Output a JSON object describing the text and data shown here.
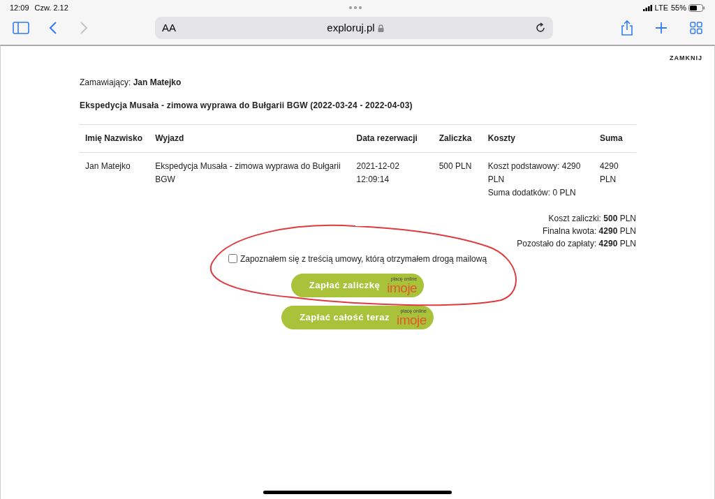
{
  "status_bar": {
    "time": "12:09",
    "date": "Czw. 2.12",
    "network": "LTE",
    "battery": "55%"
  },
  "browser": {
    "reader_button": "AA",
    "url": "exploruj.pl"
  },
  "close_link": "ZAMKNIJ",
  "orderer": {
    "label": "Zamawiający:",
    "name": "Jan Matejko"
  },
  "trip_title": "Ekspedycja Musała - zimowa wyprawa do Bułgarii BGW (2022-03-24 - 2022-04-03)",
  "table": {
    "columns": [
      "Imię Nazwisko",
      "Wyjazd",
      "Data rezerwacji",
      "Zaliczka",
      "Koszty",
      "Suma"
    ],
    "rows": [
      [
        "Jan Matejko",
        "Ekspedycja Musała - zimowa wyprawa do Bułgarii BGW",
        "2021-12-02 12:09:14",
        "500 PLN",
        "Koszt podstawowy: 4290 PLN\nSuma dodatków: 0 PLN",
        "4290 PLN"
      ]
    ]
  },
  "summary": [
    "Koszt zaliczki: **500** PLN",
    "Finalna kwota: **4290** PLN",
    "Pozostało do zapłaty: **4290** PLN"
  ],
  "agreement": {
    "label": "Zapoznałem się z treścią umowy, którą otrzymałem drogą mailową",
    "checked": false
  },
  "pay_buttons": [
    {
      "label": "Zapłać zaliczkę",
      "logo_caption": "płacę online",
      "logo": "imoje"
    },
    {
      "label": "Zapłać całość teraz",
      "logo_caption": "płacę online",
      "logo": "imoje"
    }
  ]
}
